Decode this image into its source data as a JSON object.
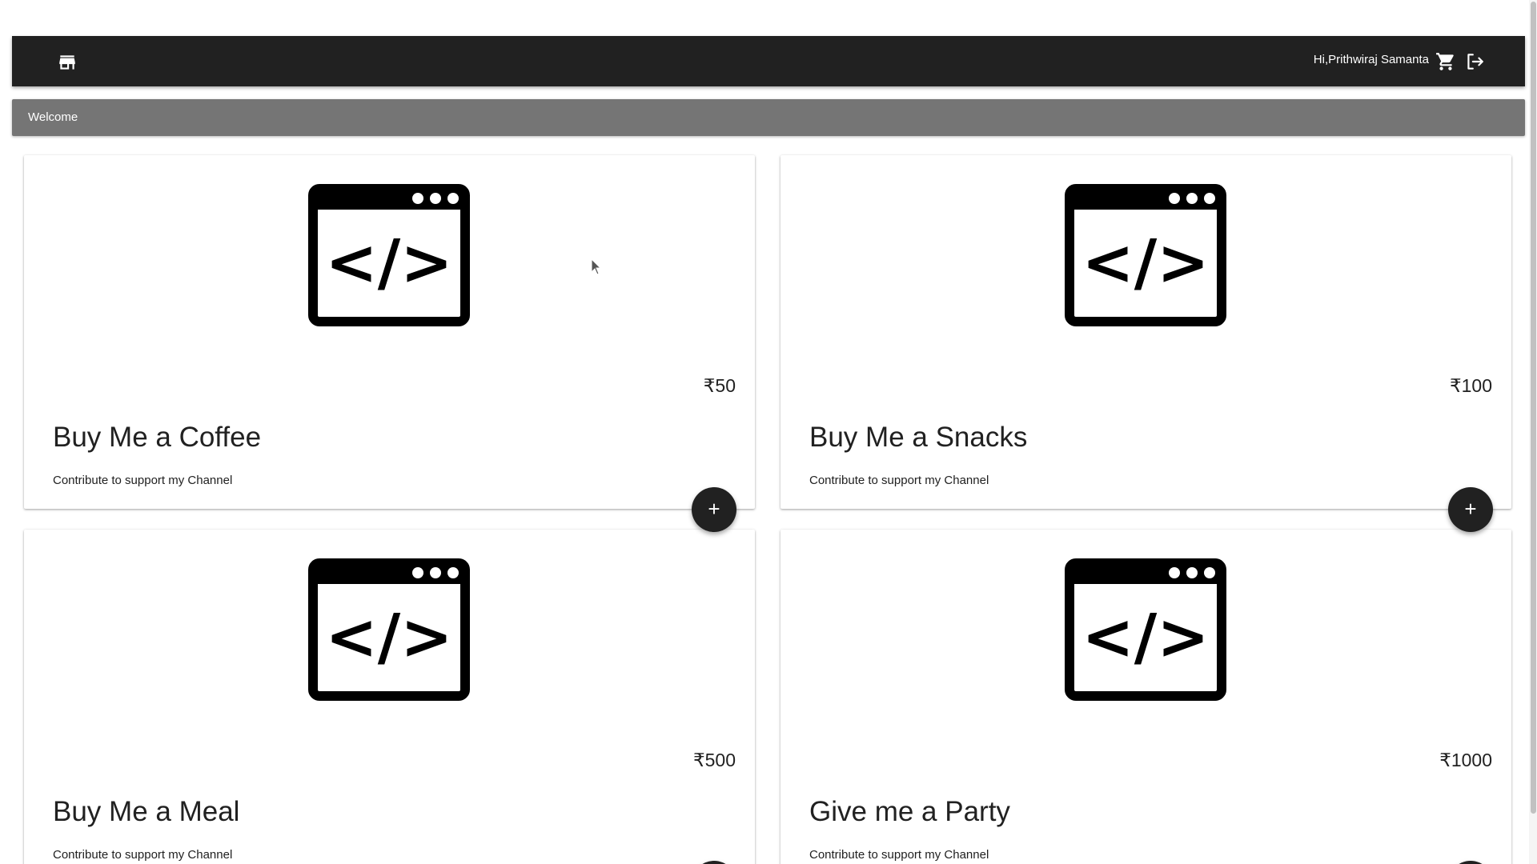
{
  "header": {
    "store_icon": "store-icon",
    "greeting": "Hi,Prithwiraj Samanta",
    "cart_icon": "cart-icon",
    "logout_icon": "logout-icon",
    "background": "#212121"
  },
  "welcome": {
    "text": "Welcome",
    "background": "#757575"
  },
  "cards": [
    {
      "price": "₹50",
      "title": "Buy Me a Coffee",
      "description": "Contribute to support my Channel",
      "image_icon": "code-window-icon",
      "add_icon": "plus-icon"
    },
    {
      "price": "₹100",
      "title": "Buy Me a Snacks",
      "description": "Contribute to support my Channel",
      "image_icon": "code-window-icon",
      "add_icon": "plus-icon"
    },
    {
      "price": "₹500",
      "title": "Buy Me a Meal",
      "description": "Contribute to support my Channel",
      "image_icon": "code-window-icon",
      "add_icon": "plus-icon"
    },
    {
      "price": "₹1000",
      "title": "Give me a Party",
      "description": "Contribute to support my Channel",
      "image_icon": "code-window-icon",
      "add_icon": "plus-icon"
    }
  ]
}
